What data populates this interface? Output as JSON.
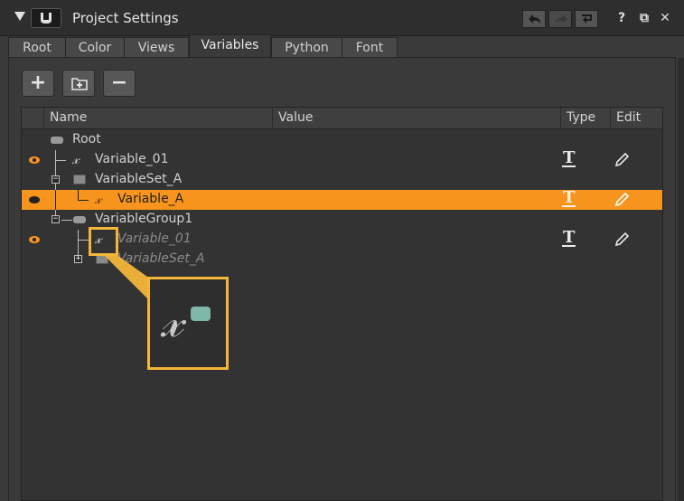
{
  "window": {
    "title": "Project Settings",
    "logo_icon": "nuke-logo-icon"
  },
  "tabs": [
    {
      "label": "Root",
      "active": false
    },
    {
      "label": "Color",
      "active": false
    },
    {
      "label": "Views",
      "active": false
    },
    {
      "label": "Variables",
      "active": true
    },
    {
      "label": "Python",
      "active": false
    },
    {
      "label": "Font",
      "active": false
    }
  ],
  "toolbar": {
    "add_label": "+",
    "remove_label": "−"
  },
  "titlebar_buttons": {
    "help_label": "?",
    "float_label": "⧉",
    "close_label": "✕"
  },
  "tree": {
    "columns": {
      "name": "Name",
      "value": "Value",
      "type": "Type",
      "edit": "Edit"
    },
    "rows": [
      {
        "label": "Root",
        "kind": "root"
      },
      {
        "label": "Variable_01",
        "kind": "variable",
        "visible": true,
        "type": "T"
      },
      {
        "label": "VariableSet_A",
        "kind": "set"
      },
      {
        "label": "Variable_A",
        "kind": "variable",
        "visible": true,
        "selected": true,
        "type": "T"
      },
      {
        "label": "VariableGroup1",
        "kind": "group"
      },
      {
        "label": "Variable_01",
        "kind": "variable",
        "visible": true,
        "inherited": true,
        "type": "T"
      },
      {
        "label": "VariableSet_A",
        "kind": "set",
        "inherited": true
      }
    ]
  },
  "colors": {
    "accent": "#f7941d",
    "callout": "#f4b63a",
    "background": "#3a3a3a"
  }
}
